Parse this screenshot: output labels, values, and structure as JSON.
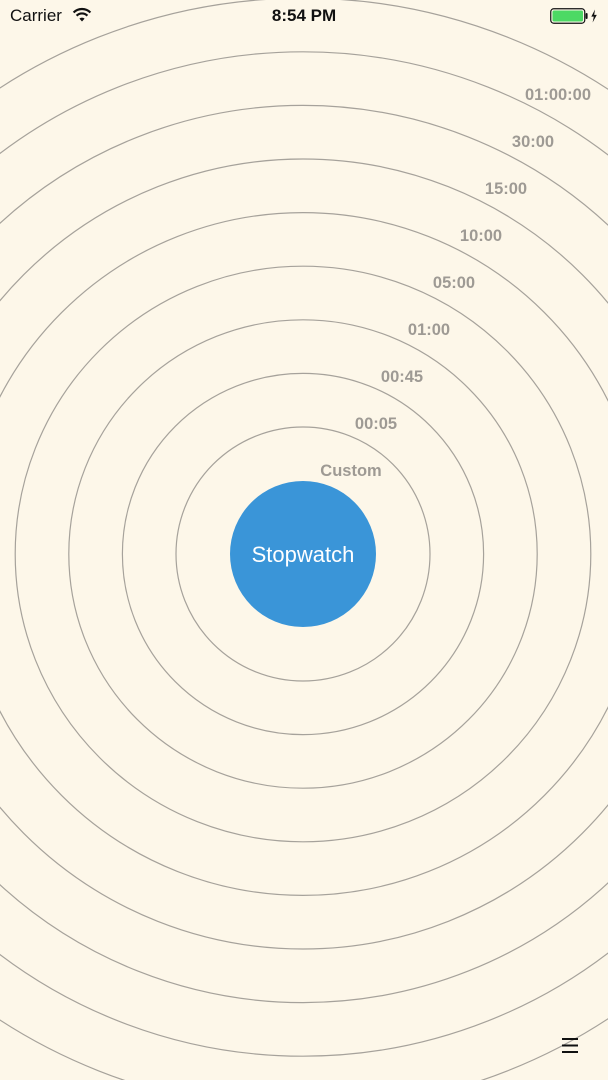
{
  "status_bar": {
    "carrier": "Carrier",
    "time": "8:54 PM",
    "icons": [
      "wifi-icon",
      "battery-icon",
      "charging-bolt-icon"
    ],
    "battery_color": "#4CD964"
  },
  "rings": [
    {
      "label": "Custom"
    },
    {
      "label": "00:05"
    },
    {
      "label": "00:45"
    },
    {
      "label": "01:00"
    },
    {
      "label": "05:00"
    },
    {
      "label": "10:00"
    },
    {
      "label": "15:00"
    },
    {
      "label": "30:00"
    },
    {
      "label": "01:00:00"
    }
  ],
  "center_button": {
    "label": "Stopwatch",
    "color": "#3A95D8"
  },
  "menu": {
    "icon": "hamburger-menu-icon"
  },
  "colors": {
    "background": "#FDF7E9",
    "ring_stroke": "#A6A29B",
    "ring_label": "#9E9A94"
  }
}
